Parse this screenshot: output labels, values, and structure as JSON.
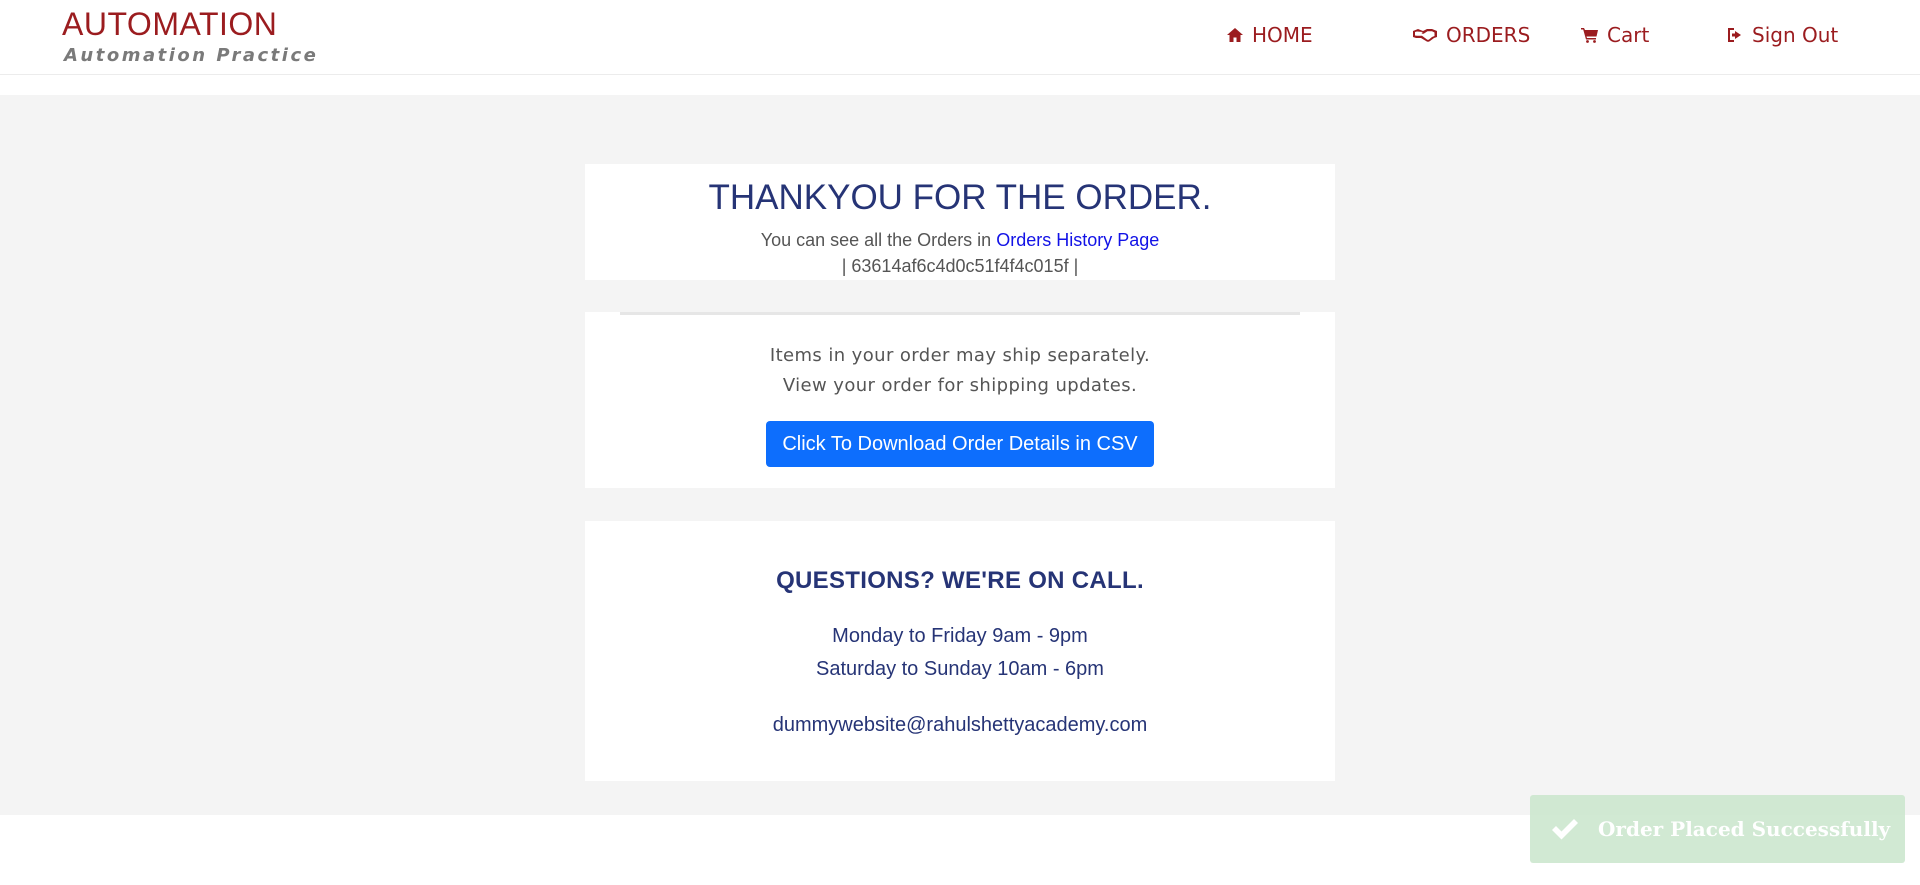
{
  "header": {
    "logo_title": "AUTOMATION",
    "logo_subtitle": "Automation Practice",
    "nav": {
      "home": "HOME",
      "orders": "ORDERS",
      "cart": "Cart",
      "signout": "Sign Out"
    }
  },
  "confirmation": {
    "title": "THANKYOU FOR THE ORDER.",
    "history_prefix": "You can see all the Orders in",
    "history_link": "Orders History Page",
    "order_id": "| 63614af6c4d0c51f4f4c015f |"
  },
  "shipping": {
    "line1": "Items in your order may ship separately.",
    "line2": "View your order for shipping updates.",
    "download_button": "Click To Download Order Details in CSV"
  },
  "support": {
    "title": "QUESTIONS? WE'RE ON CALL.",
    "hours_weekday": "Monday to Friday 9am - 9pm",
    "hours_weekend": "Saturday to Sunday 10am - 6pm",
    "email": "dummywebsite@rahulshettyacademy.com"
  },
  "toast": {
    "message": "Order Placed Successfully",
    "icon": "check-icon"
  },
  "colors": {
    "brand": "#9b1c1f",
    "heading": "#263476",
    "button": "#0d6efd",
    "link": "#1212e6",
    "toast_bg": "#cfe8d1"
  }
}
